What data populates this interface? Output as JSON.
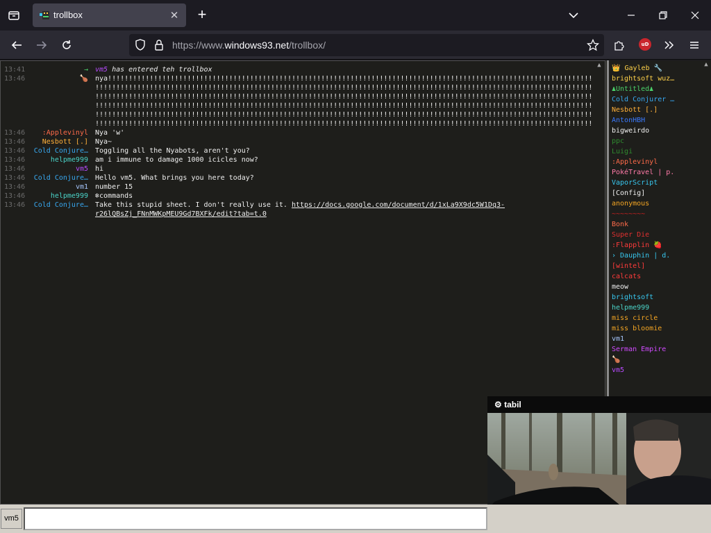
{
  "browser": {
    "tab": {
      "title": "trollbox"
    },
    "url": {
      "scheme": "https://www.",
      "host": "windows93.net",
      "path": "/trollbox/"
    }
  },
  "colors": {
    "time": "#6c6c6c",
    "text": "#f0f0f0",
    "orange": "#f5a623",
    "coral": "#ff6b4a",
    "blue": "#3aa0ff",
    "cyan": "#38c8f0",
    "green": "#4bd36b",
    "purple": "#b84bff",
    "magenta": "#d04bff",
    "red": "#ff3b3b",
    "yellow": "#ffd24a",
    "white": "#f0f0f0"
  },
  "messages": [
    {
      "time": "13:41",
      "nick": "→",
      "text": "vm5 has entered teh trollbox",
      "nick_color": "#4bd36b",
      "type": "system"
    },
    {
      "time": "13:46",
      "nick": "🍗",
      "text": "nya!!!!!!!!!!!!!!!!!!!!!!!!!!!!!!!!!!!!!!!!!!!!!!!!!!!!!!!!!!!!!!!!!!!!!!!!!!!!!!!!!!!!!!!!!!!!!!!!!!!!!!!!!!!!!!!!!!!!!!!!!!!!",
      "nick_color": "#f5a623"
    },
    {
      "time": "13:46",
      "nick": ":Applevinyl",
      "text": "Nya 'w'",
      "nick_color": "#ff6b4a"
    },
    {
      "time": "13:46",
      "nick": "Nesbott [.]",
      "text": "Nya~",
      "nick_color": "#ffb03a"
    },
    {
      "time": "13:46",
      "nick": "Cold Conjure…",
      "text": "Toggling all the Nyabots, aren't you?",
      "nick_color": "#38a8f0"
    },
    {
      "time": "13:46",
      "nick": "helpme999",
      "text": "am i immune to damage 1000 icicles now?",
      "nick_color": "#4bd3c8"
    },
    {
      "time": "13:46",
      "nick": "vm5",
      "text": "hi",
      "nick_color": "#b84bff"
    },
    {
      "time": "13:46",
      "nick": "Cold Conjure…",
      "text": "Hello vm5. What brings you here today?",
      "nick_color": "#38a8f0"
    },
    {
      "time": "13:46",
      "nick": "vm1",
      "text": "number 15",
      "nick_color": "#a8c8ff"
    },
    {
      "time": "13:46",
      "nick": "helpme999",
      "text": "❄commands",
      "nick_color": "#4bd3c8"
    },
    {
      "time": "13:46",
      "nick": "Cold Conjure…",
      "text": "Take this stupid sheet. I don't really use it. ",
      "nick_color": "#38a8f0"
    }
  ],
  "nya_continuation": [
    "!!!!!!!!!!!!!!!!!!!!!!!!!!!!!!!!!!!!!!!!!!!!!!!!!!!!!!!!!!!!!!!!!!!!!!!!!!!!!!!!!!!!!!!!!!!!!!!!!!!!!!!!!!!!!!!!!!!!!!!!!!!!!!!!",
    "!!!!!!!!!!!!!!!!!!!!!!!!!!!!!!!!!!!!!!!!!!!!!!!!!!!!!!!!!!!!!!!!!!!!!!!!!!!!!!!!!!!!!!!!!!!!!!!!!!!!!!!!!!!!!!!!!!!!!!!!!!!!!!!!",
    "!!!!!!!!!!!!!!!!!!!!!!!!!!!!!!!!!!!!!!!!!!!!!!!!!!!!!!!!!!!!!!!!!!!!!!!!!!!!!!!!!!!!!!!!!!!!!!!!!!!!!!!!!!!!!!!!!!!!!!!!!!!!!!!!",
    "!!!!!!!!!!!!!!!!!!!!!!!!!!!!!!!!!!!!!!!!!!!!!!!!!!!!!!!!!!!!!!!!!!!!!!!!!!!!!!!!!!!!!!!!!!!!!!!!!!!!!!!!!!!!!!!!!!!!!!!!!!!!!!!!",
    "!!!!!!!!!!!!!!!!!!!!!!!!!!!!!!!!!!!!!!!!!!!!!!!!!!!!!!!!!!!!!!!!!!!!!!!!!!!!!!!!!!!!!!!!!!!!!!!!!!!!!!!!!!!!!!!!!!!!!!!!!!!!!!!!",
    "!!!!!!!!!!!!!!!!!!!!!!!!!!!!!!!!!"
  ],
  "link": {
    "line1": "https://docs.google.com/document/d/1xLa9X9dc5W1Dq3-",
    "line2": "r26lQBsZj_FNnMWKpMEU9Gd7BXFk/edit?tab=t.0"
  },
  "users": [
    {
      "name": "👑 Gayleb 🔧",
      "color": "#ffd24a"
    },
    {
      "name": "brightsoft wuz…",
      "color": "#ffd24a"
    },
    {
      "name": "♟Untitled♟",
      "color": "#4bd36b"
    },
    {
      "name": "Cold Conjurer …",
      "color": "#38a8f0"
    },
    {
      "name": "Nesbott [.]",
      "color": "#ffb03a"
    },
    {
      "name": "AntonHBH",
      "color": "#3a7aff"
    },
    {
      "name": "bigweirdo",
      "color": "#f0f0f0"
    },
    {
      "name": "ppc",
      "color": "#2f8a2f"
    },
    {
      "name": "Luigi",
      "color": "#2f8a2f"
    },
    {
      "name": ":Applevinyl",
      "color": "#ff6b4a"
    },
    {
      "name": "PokéTravel | p.",
      "color": "#ff7aa8"
    },
    {
      "name": "VaporScript",
      "color": "#38c8f0"
    },
    {
      "name": "[Config]",
      "color": "#f0f0f0"
    },
    {
      "name": "anonymous",
      "color": "#f5a623"
    },
    {
      "name": "~~~~~~~~",
      "color": "#d02020"
    },
    {
      "name": "Bonk",
      "color": "#ff6b4a"
    },
    {
      "name": "Super Die",
      "color": "#e03030"
    },
    {
      "name": ":Flapplin 🍓",
      "color": "#ff3b3b"
    },
    {
      "name": "› Dauphin | d.",
      "color": "#38c8f0"
    },
    {
      "name": "[wintel]",
      "color": "#ff3b3b"
    },
    {
      "name": "calcats",
      "color": "#ff3b3b"
    },
    {
      "name": "meow",
      "color": "#f0f0f0"
    },
    {
      "name": "brightsoft",
      "color": "#38c8f0"
    },
    {
      "name": "helpme999",
      "color": "#4bd3c8"
    },
    {
      "name": "miss circle",
      "color": "#f5a623"
    },
    {
      "name": "miss bloomie",
      "color": "#f5a623"
    },
    {
      "name": "vm1",
      "color": "#a8c8ff"
    },
    {
      "name": "Serman Empire",
      "color": "#d04bff"
    },
    {
      "name": "🍗",
      "color": "#f5a623"
    },
    {
      "name": "vm5",
      "color": "#b84bff"
    }
  ],
  "pip": {
    "brand": "tabil"
  },
  "input": {
    "nick": "vm5",
    "value": ""
  }
}
